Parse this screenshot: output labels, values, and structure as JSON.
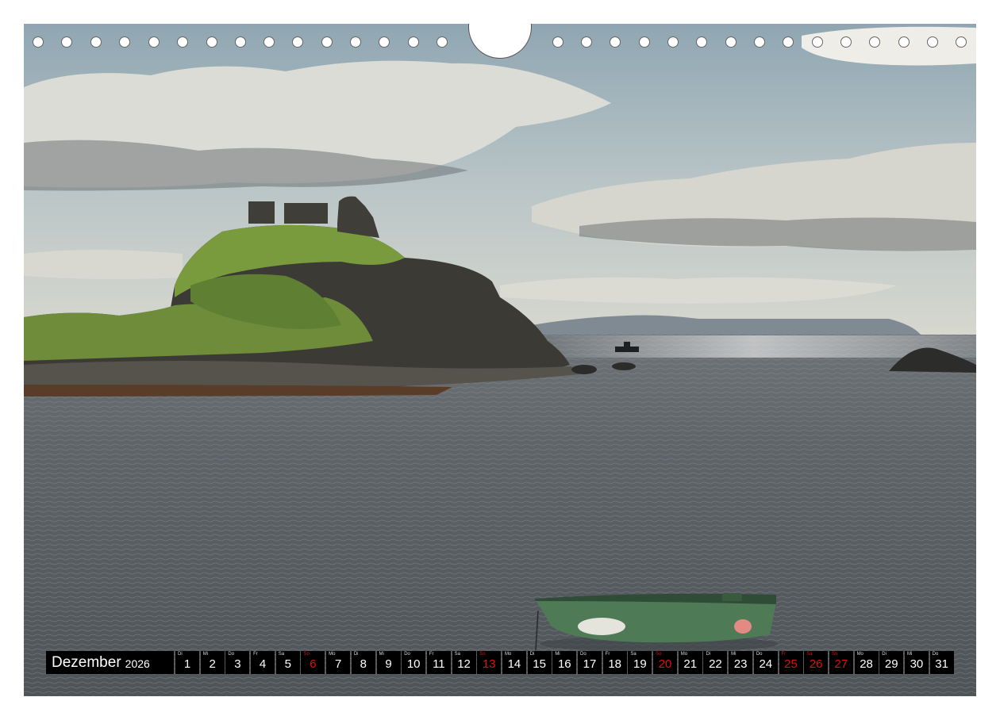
{
  "calendar": {
    "month": "Dezember",
    "year": "2026",
    "days": [
      {
        "wd": "Di",
        "n": "1",
        "red": false
      },
      {
        "wd": "Mi",
        "n": "2",
        "red": false
      },
      {
        "wd": "Do",
        "n": "3",
        "red": false
      },
      {
        "wd": "Fr",
        "n": "4",
        "red": false
      },
      {
        "wd": "Sa",
        "n": "5",
        "red": false
      },
      {
        "wd": "So",
        "n": "6",
        "red": true
      },
      {
        "wd": "Mo",
        "n": "7",
        "red": false
      },
      {
        "wd": "Di",
        "n": "8",
        "red": false
      },
      {
        "wd": "Mi",
        "n": "9",
        "red": false
      },
      {
        "wd": "Do",
        "n": "10",
        "red": false
      },
      {
        "wd": "Fr",
        "n": "11",
        "red": false
      },
      {
        "wd": "Sa",
        "n": "12",
        "red": false
      },
      {
        "wd": "So",
        "n": "13",
        "red": true
      },
      {
        "wd": "Mo",
        "n": "14",
        "red": false
      },
      {
        "wd": "Di",
        "n": "15",
        "red": false
      },
      {
        "wd": "Mi",
        "n": "16",
        "red": false
      },
      {
        "wd": "Do",
        "n": "17",
        "red": false
      },
      {
        "wd": "Fr",
        "n": "18",
        "red": false
      },
      {
        "wd": "Sa",
        "n": "19",
        "red": false
      },
      {
        "wd": "So",
        "n": "20",
        "red": true
      },
      {
        "wd": "Mo",
        "n": "21",
        "red": false
      },
      {
        "wd": "Di",
        "n": "22",
        "red": false
      },
      {
        "wd": "Mi",
        "n": "23",
        "red": false
      },
      {
        "wd": "Do",
        "n": "24",
        "red": false
      },
      {
        "wd": "Fr",
        "n": "25",
        "red": true
      },
      {
        "wd": "Sa",
        "n": "26",
        "red": true
      },
      {
        "wd": "So",
        "n": "27",
        "red": true
      },
      {
        "wd": "Mo",
        "n": "28",
        "red": false
      },
      {
        "wd": "Di",
        "n": "29",
        "red": false
      },
      {
        "wd": "Mi",
        "n": "30",
        "red": false
      },
      {
        "wd": "Do",
        "n": "31",
        "red": false
      }
    ]
  },
  "colors": {
    "holiday": "#e01010",
    "bar": "#000000"
  }
}
